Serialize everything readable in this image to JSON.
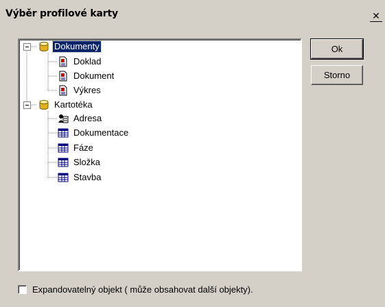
{
  "window": {
    "title": "Výběr profilové karty",
    "close_glyph": "✕"
  },
  "tree": {
    "nodes": [
      {
        "label": "Dokumenty",
        "icon": "database-icon",
        "selected": true,
        "expanded": true
      },
      {
        "label": "Doklad",
        "icon": "document-icon"
      },
      {
        "label": "Dokument",
        "icon": "document-icon"
      },
      {
        "label": "Výkres",
        "icon": "document-icon"
      },
      {
        "label": "Kartotéka",
        "icon": "database-icon",
        "expanded": true
      },
      {
        "label": "Adresa",
        "icon": "address-card-icon"
      },
      {
        "label": "Dokumentace",
        "icon": "table-icon"
      },
      {
        "label": "Fáze",
        "icon": "table-icon"
      },
      {
        "label": "Složka",
        "icon": "table-icon"
      },
      {
        "label": "Stavba",
        "icon": "table-icon"
      }
    ]
  },
  "buttons": {
    "ok_label": "Ok",
    "cancel_label": "Storno"
  },
  "checkbox": {
    "label": "Expandovatelný objekt ( může obsahovat další objekty).",
    "checked": false
  },
  "colors": {
    "dialog_bg": "#d4d0c8",
    "selection_bg": "#0a246a",
    "selection_fg": "#ffffff"
  }
}
